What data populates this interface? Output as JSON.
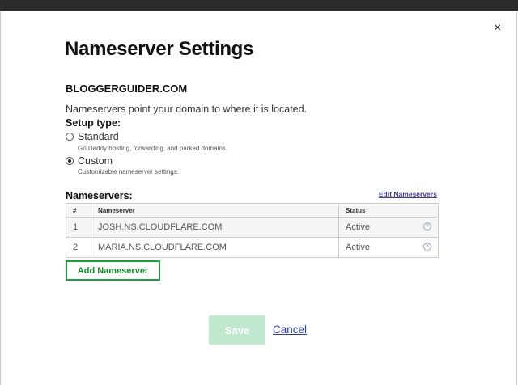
{
  "dialog": {
    "title": "Nameserver Settings",
    "close": "×",
    "domain": "BLOGGERGUIDER.COM",
    "description": "Nameservers point your domain to where it is located.",
    "setup_label": "Setup type:"
  },
  "options": [
    {
      "label": "Standard",
      "sub": "Go Daddy hosting, forwarding, and parked domains.",
      "selected": false
    },
    {
      "label": "Custom",
      "sub": "Customizable nameserver settings.",
      "selected": true
    }
  ],
  "nameservers": {
    "label": "Nameservers:",
    "edit_link": "Edit Nameservers",
    "headers": [
      "#",
      "Nameserver",
      "Status"
    ],
    "rows": [
      {
        "num": "1",
        "name": "JOSH.NS.CLOUDFLARE.COM",
        "status": "Active"
      },
      {
        "num": "2",
        "name": "MARIA.NS.CLOUDFLARE.COM",
        "status": "Active"
      }
    ]
  },
  "buttons": {
    "add": "Add Nameserver",
    "save": "Save",
    "cancel": "Cancel"
  }
}
